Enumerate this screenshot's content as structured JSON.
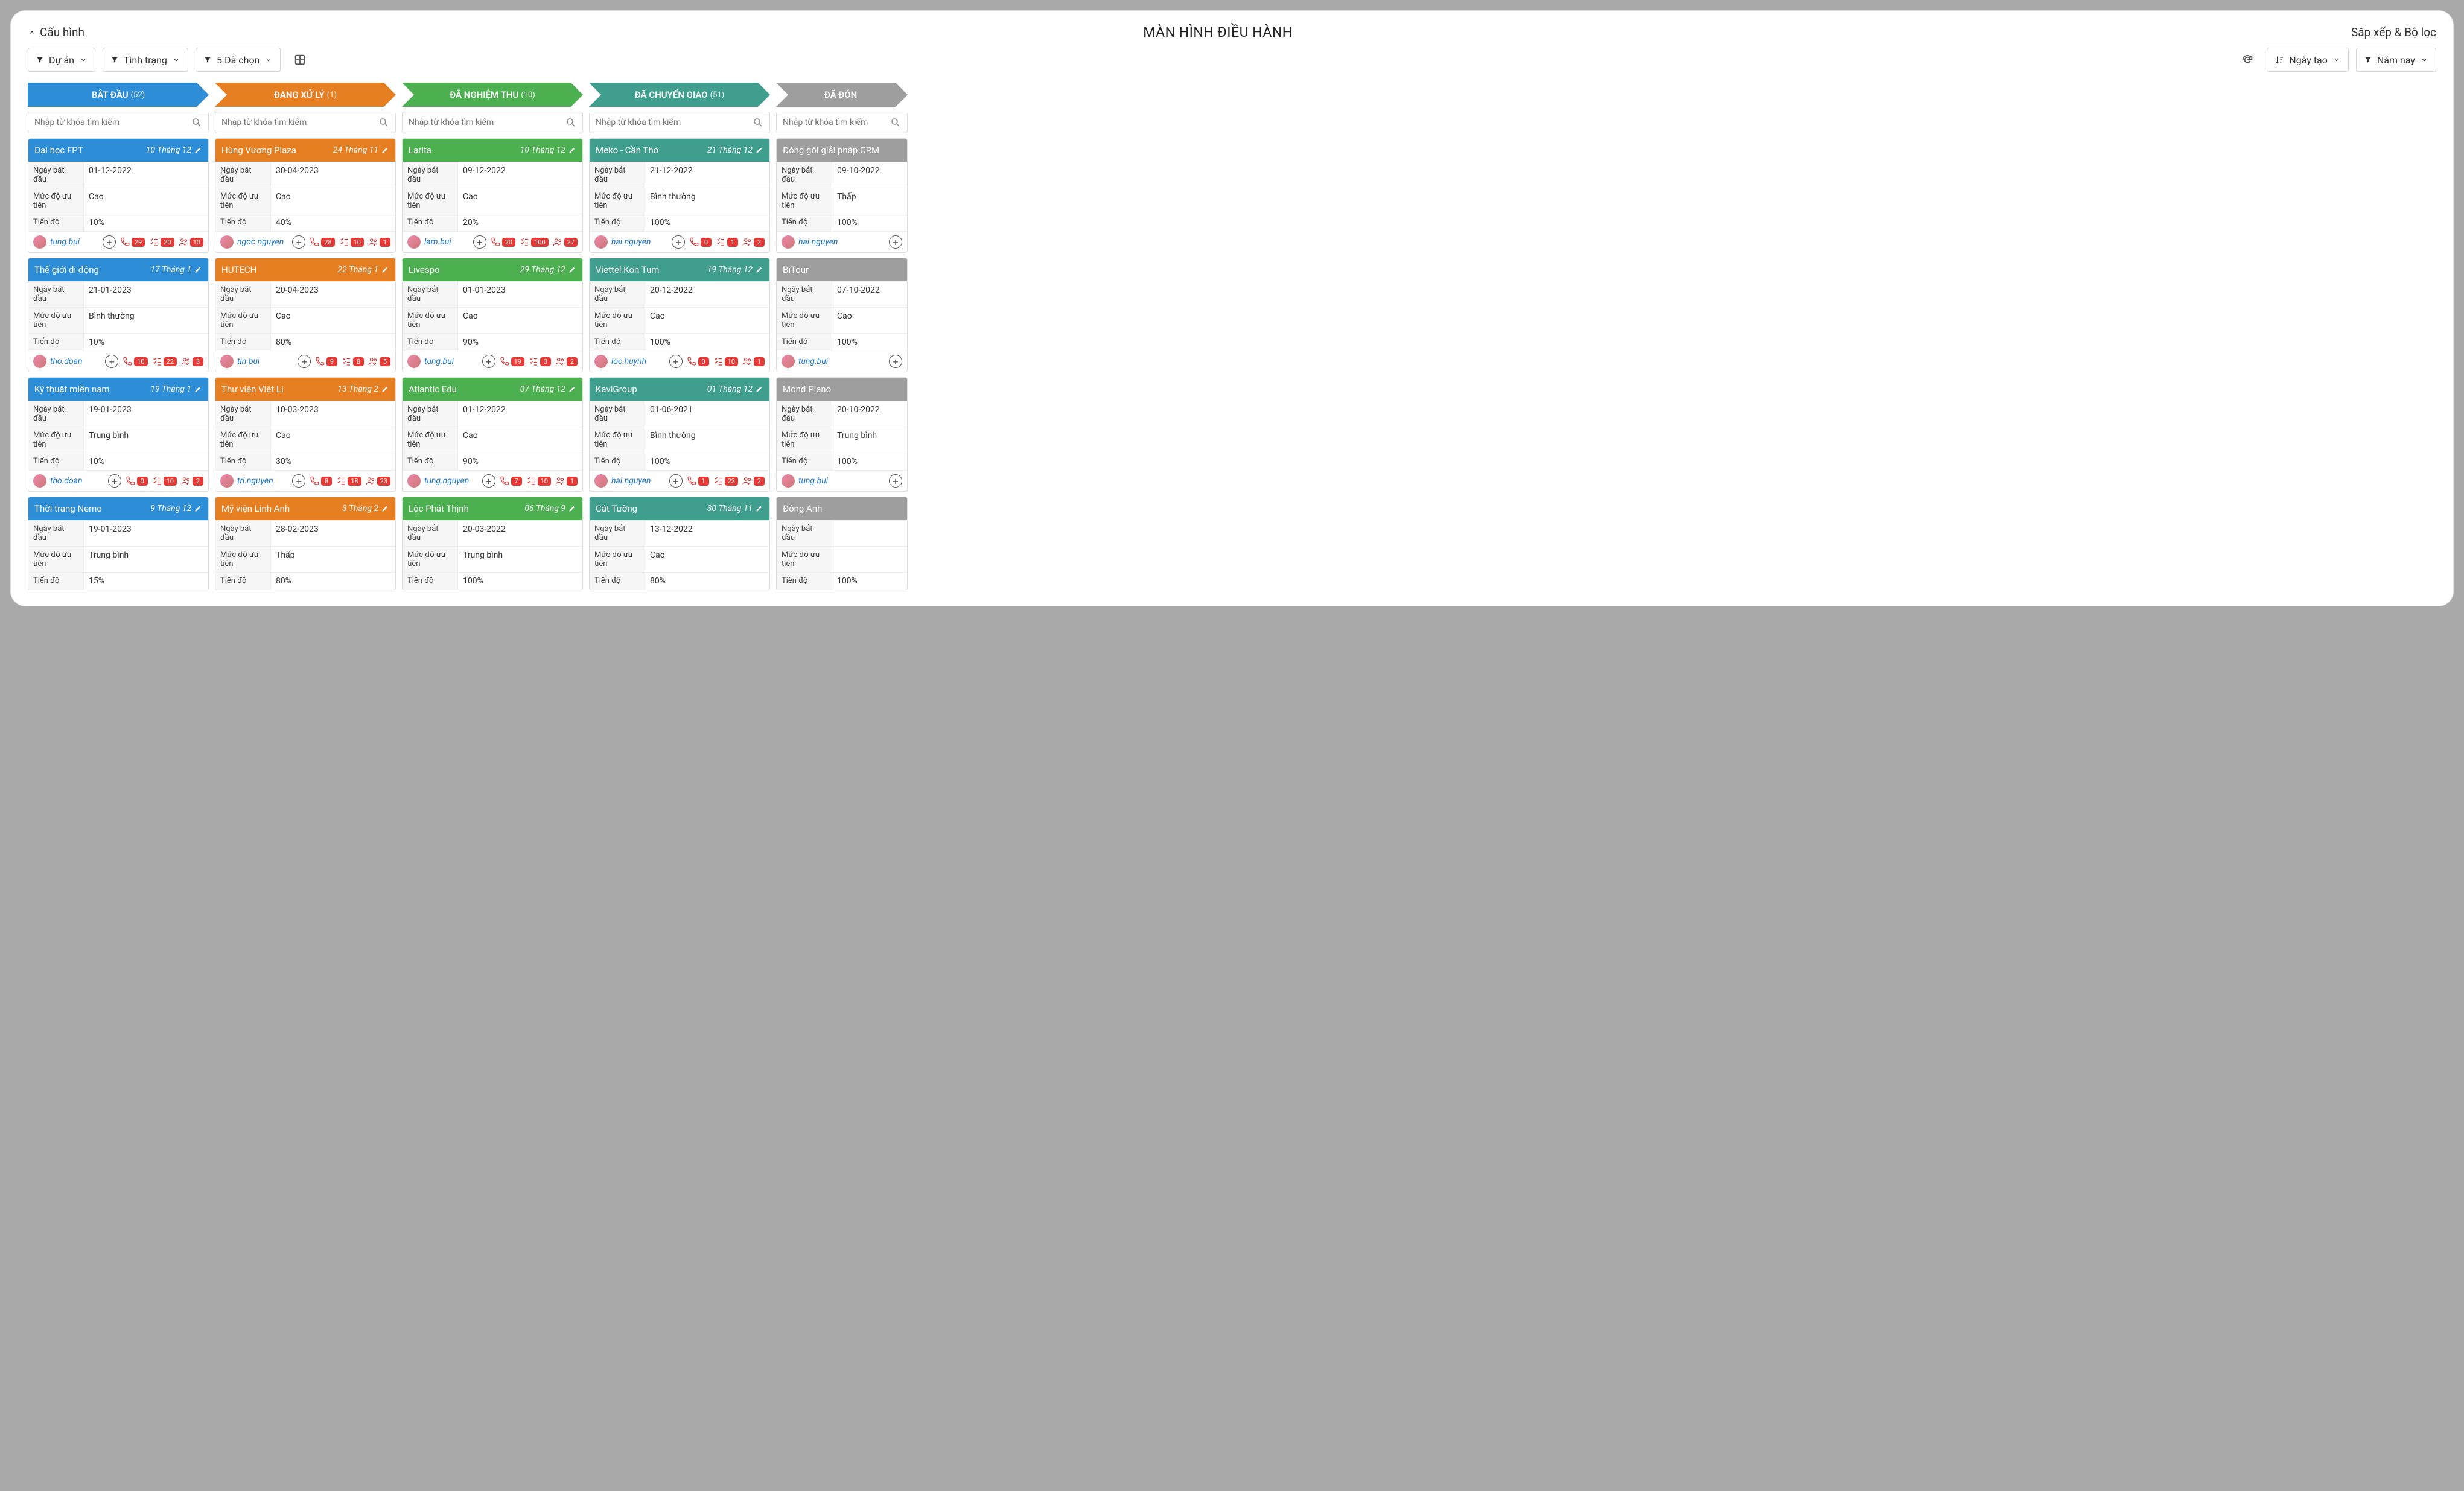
{
  "header": {
    "config": "Cấu hình",
    "title": "MÀN HÌNH ĐIỀU HÀNH",
    "sort": "Sắp xếp & Bộ lọc"
  },
  "toolbar": {
    "project": "Dự án",
    "status": "Tình trạng",
    "selected": "5 Đã chọn",
    "created": "Ngày tạo",
    "year": "Năm nay"
  },
  "searchPlaceholder": "Nhập từ khóa tìm kiếm",
  "labels": {
    "start": "Ngày bắt đầu",
    "priority": "Mức độ ưu tiên",
    "progress": "Tiến độ"
  },
  "stages": [
    {
      "name": "BẮT ĐẦU",
      "count": "(52)",
      "color": "blue",
      "cards": [
        {
          "title": "Đại học FPT",
          "due": "10 Tháng 12",
          "start": "01-12-2022",
          "priority": "Cao",
          "progress": "10%",
          "user": "tung.bui",
          "stats": [
            29,
            20,
            10
          ]
        },
        {
          "title": "Thế giới di động",
          "due": "17 Tháng 1",
          "start": "21-01-2023",
          "priority": "Bình thường",
          "progress": "10%",
          "user": "tho.doan",
          "stats": [
            10,
            22,
            3
          ]
        },
        {
          "title": "Kỹ thuật miền nam",
          "due": "19 Tháng 1",
          "start": "19-01-2023",
          "priority": "Trung bình",
          "progress": "10%",
          "user": "tho.doan",
          "stats": [
            0,
            10,
            2
          ]
        },
        {
          "title": "Thời trang Nemo",
          "due": "9 Tháng 12",
          "start": "19-01-2023",
          "priority": "Trung bình",
          "progress": "15%",
          "user": "",
          "stats": []
        }
      ]
    },
    {
      "name": "ĐANG XỬ LÝ",
      "count": "(1)",
      "color": "orange",
      "cards": [
        {
          "title": "Hùng Vương Plaza",
          "due": "24 Tháng 11",
          "start": "30-04-2023",
          "priority": "Cao",
          "progress": "40%",
          "user": "ngoc.nguyen",
          "stats": [
            28,
            10,
            1
          ]
        },
        {
          "title": "HUTECH",
          "due": "22 Tháng 1",
          "start": "20-04-2023",
          "priority": "Cao",
          "progress": "80%",
          "user": "tin.bui",
          "stats": [
            9,
            8,
            5
          ]
        },
        {
          "title": "Thư viện Việt Li",
          "due": "13 Tháng 2",
          "start": "10-03-2023",
          "priority": "Cao",
          "progress": "30%",
          "user": "tri.nguyen",
          "stats": [
            8,
            18,
            23
          ]
        },
        {
          "title": "Mỹ viện Linh Anh",
          "due": "3 Tháng 2",
          "start": "28-02-2023",
          "priority": "Thấp",
          "progress": "80%",
          "user": "",
          "stats": []
        }
      ]
    },
    {
      "name": "ĐÃ NGHIỆM THU",
      "count": "(10)",
      "color": "green",
      "cards": [
        {
          "title": "Larita",
          "due": "10 Tháng 12",
          "start": "09-12-2022",
          "priority": "Cao",
          "progress": "20%",
          "user": "lam.bui",
          "stats": [
            20,
            100,
            27
          ]
        },
        {
          "title": "Livespo",
          "due": "29 Tháng 12",
          "start": "01-01-2023",
          "priority": "Cao",
          "progress": "90%",
          "user": "tung.bui",
          "stats": [
            19,
            3,
            2
          ]
        },
        {
          "title": "Atlantic Edu",
          "due": "07 Tháng 12",
          "start": "01-12-2022",
          "priority": "Cao",
          "progress": "90%",
          "user": "tung.nguyen",
          "stats": [
            7,
            10,
            1
          ]
        },
        {
          "title": "Lộc Phát Thịnh",
          "due": "06 Tháng 9",
          "start": "20-03-2022",
          "priority": "Trung bình",
          "progress": "100%",
          "user": "",
          "stats": []
        }
      ]
    },
    {
      "name": "ĐÃ CHUYỂN GIAO",
      "count": "(51)",
      "color": "teal",
      "cards": [
        {
          "title": "Meko - Cần Thơ",
          "due": "21 Tháng 12",
          "start": "21-12-2022",
          "priority": "Bình thường",
          "progress": "100%",
          "user": "hai.nguyen",
          "stats": [
            0,
            1,
            2
          ]
        },
        {
          "title": "Viettel Kon Tum",
          "due": "19 Tháng 12",
          "start": "20-12-2022",
          "priority": "Cao",
          "progress": "100%",
          "user": "loc.huynh",
          "stats": [
            0,
            10,
            1
          ]
        },
        {
          "title": "KaviGroup",
          "due": "01 Tháng 12",
          "start": "01-06-2021",
          "priority": "Bình thường",
          "progress": "100%",
          "user": "hai.nguyen",
          "stats": [
            1,
            23,
            2
          ]
        },
        {
          "title": "Cát Tường",
          "due": "30 Tháng 11",
          "start": "13-12-2022",
          "priority": "Cao",
          "progress": "80%",
          "user": "",
          "stats": []
        }
      ]
    },
    {
      "name": "ĐÃ ĐÓN",
      "count": "",
      "color": "gray",
      "cards": [
        {
          "title": "Đóng gói giải pháp CRM",
          "due": "",
          "start": "09-10-2022",
          "priority": "Thấp",
          "progress": "100%",
          "user": "hai.nguyen",
          "stats": []
        },
        {
          "title": "BiTour",
          "due": "",
          "start": "07-10-2022",
          "priority": "Cao",
          "progress": "100%",
          "user": "tung.bui",
          "stats": []
        },
        {
          "title": "Mond Piano",
          "due": "",
          "start": "20-10-2022",
          "priority": "Trung bình",
          "progress": "100%",
          "user": "tung.bui",
          "stats": []
        },
        {
          "title": "Đông Anh",
          "due": "",
          "start": "",
          "priority": "",
          "progress": "100%",
          "user": "",
          "stats": []
        }
      ]
    }
  ]
}
